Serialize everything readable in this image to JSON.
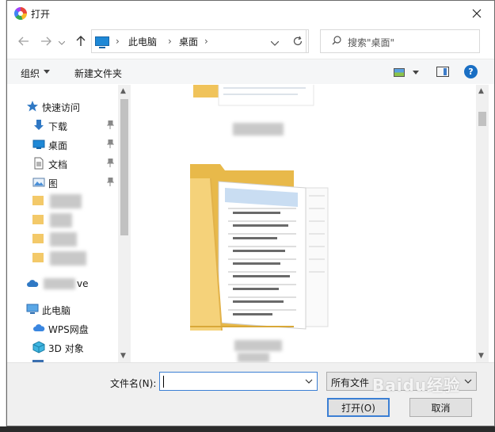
{
  "window": {
    "title": "打开"
  },
  "address": {
    "crumbs": [
      "此电脑",
      "桌面"
    ],
    "search_placeholder": "搜索\"桌面\""
  },
  "toolbar": {
    "organize_label": "组织",
    "new_folder_label": "新建文件夹"
  },
  "nav_pane": {
    "quick_access": "快速访问",
    "pinned": [
      {
        "label": "下载",
        "icon": "download-icon"
      },
      {
        "label": "桌面",
        "icon": "desktop-icon"
      },
      {
        "label": "文档",
        "icon": "document-icon"
      },
      {
        "label": "图片",
        "icon": "picture-icon"
      }
    ],
    "onedrive_suffix": "ve",
    "this_pc": "此电脑",
    "wps_cloud": "WPS网盘",
    "objects_3d": "3D 对象"
  },
  "bottom": {
    "filename_label": "文件名(N):",
    "filename_value": "",
    "filetype_value": "所有文件",
    "open_button": "打开(O)",
    "cancel_button": "取消"
  },
  "watermark_text": "Baidu经验",
  "colors": {
    "accent": "#3b7fd4",
    "folder": "#f3c969",
    "help": "#1a6fc4"
  }
}
